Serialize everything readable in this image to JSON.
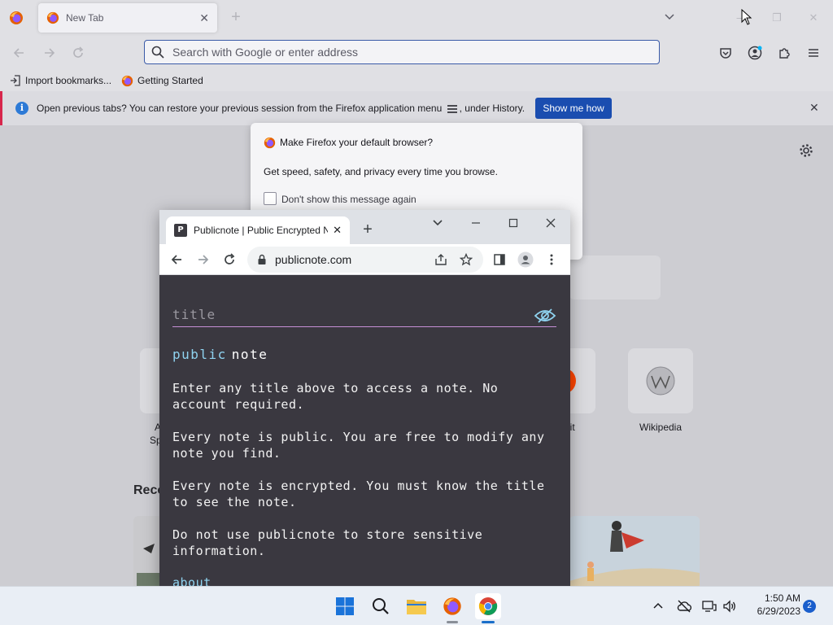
{
  "firefox": {
    "tab": {
      "title": "New Tab"
    },
    "urlbar": {
      "placeholder": "Search with Google or enter address"
    },
    "bookmarks": [
      {
        "label": "Import bookmarks..."
      },
      {
        "label": "Getting Started"
      }
    ],
    "notice": {
      "text_before": "Open previous tabs? You can restore your previous session from the Firefox application menu",
      "text_after": ", under History.",
      "button": "Show me how"
    },
    "default_dialog": {
      "title": "Make Firefox your default browser?",
      "body": "Get speed, safety, and privacy every time you browse.",
      "checkbox_label": "Don't show this message again"
    },
    "shortcuts": [
      {
        "label": "A",
        "sub": "Sp"
      },
      {
        "label": "lit"
      },
      {
        "label": "Wikipedia"
      }
    ],
    "recent_label": "Reco"
  },
  "chrome": {
    "tab": {
      "title": "Publicnote | Public Encrypted N"
    },
    "url": "publicnote.com",
    "page": {
      "title_placeholder": "title",
      "brand_a": "public",
      "brand_b": "note",
      "para1": "Enter any title above to access a note. No account required.",
      "para2": "Every note is public. You are free to modify any note you find.",
      "para3": "Every note is encrypted. You must know the title to see the note.",
      "para4": "Do not use publicnote to store sensitive information.",
      "about": "about"
    }
  },
  "taskbar": {
    "time": "1:50 AM",
    "date": "6/29/2023",
    "notification_count": "2"
  },
  "colors": {
    "ff_accent": "#1a4db0",
    "pn_bg": "#3a3840",
    "pn_brand": "#8fd3f0",
    "pn_underline": "#c58fd6"
  }
}
